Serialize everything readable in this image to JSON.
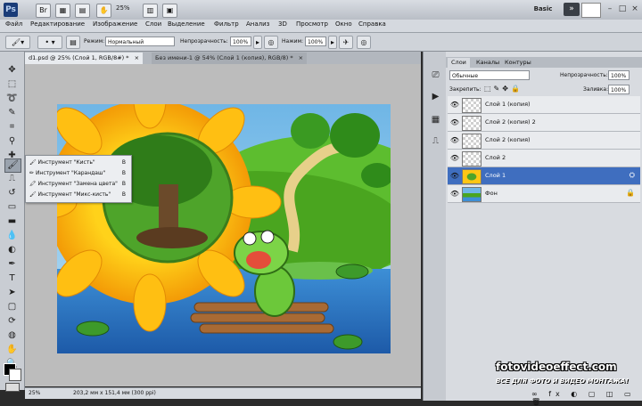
{
  "app": {
    "logo": "Ps",
    "zoom_menu": "25%",
    "workspace": "Basic",
    "window_min": "–",
    "window_max": "□",
    "window_close": "×"
  },
  "menu": [
    "Файл",
    "Редактирование",
    "Изображение",
    "Слои",
    "Выделение",
    "Фильтр",
    "Анализ",
    "3D",
    "Просмотр",
    "Окно",
    "Справка"
  ],
  "options": {
    "mode_label": "Режим:",
    "mode_value": "Нормальный",
    "opacity_label": "Непрозрачность:",
    "opacity_value": "100%",
    "flow_label": "Нажим:",
    "flow_value": "100%"
  },
  "tabs": [
    {
      "label": "d1.psd @ 25% (Слой 1, RGB/8#) *",
      "close": "×"
    },
    {
      "label": "Без имени-1 @ 54% (Слой 1 (копия), RGB/8) *",
      "close": "×"
    }
  ],
  "flyout": [
    {
      "label": "Инструмент \"Кисть\"",
      "key": "B",
      "selected": true
    },
    {
      "label": "Инструмент \"Карандаш\"",
      "key": "B",
      "selected": false
    },
    {
      "label": "Инструмент \"Замена цвета\"",
      "key": "B",
      "selected": false
    },
    {
      "label": "Инструмент \"Микс-кисть\"",
      "key": "B",
      "selected": false
    }
  ],
  "status": {
    "zoom": "25%",
    "size": "203,2 мм x 151,4 мм (300 ppi)"
  },
  "panel": {
    "tabs": [
      "Слои",
      "Каналы",
      "Контуры"
    ],
    "blend_mode": "Обычные",
    "opacity_label": "Непрозрачность:",
    "opacity_value": "100%",
    "lock_label": "Закрепить:",
    "fill_label": "Заливка:",
    "fill_value": "100%",
    "layers": [
      {
        "name": "Слой 1 (копия)",
        "selected": false,
        "thumb": "transparent"
      },
      {
        "name": "Слой 2 (копия) 2",
        "selected": false,
        "thumb": "transparent"
      },
      {
        "name": "Слой 2 (копия)",
        "selected": false,
        "thumb": "transparent"
      },
      {
        "name": "Слой 2",
        "selected": false,
        "thumb": "transparent"
      },
      {
        "name": "Слой 1",
        "selected": true,
        "thumb": "sunflower"
      },
      {
        "name": "Фон",
        "selected": false,
        "thumb": "landscape",
        "locked": true
      }
    ]
  },
  "watermark": {
    "site": "fotovideoeffect.com",
    "slogan": "ВСЕ ДЛЯ ФОТО И ВИДЕО МОНТАЖА!"
  },
  "colors": {
    "selection": "#3f6ebf",
    "foreground": "#000000",
    "background": "#ffffff"
  }
}
